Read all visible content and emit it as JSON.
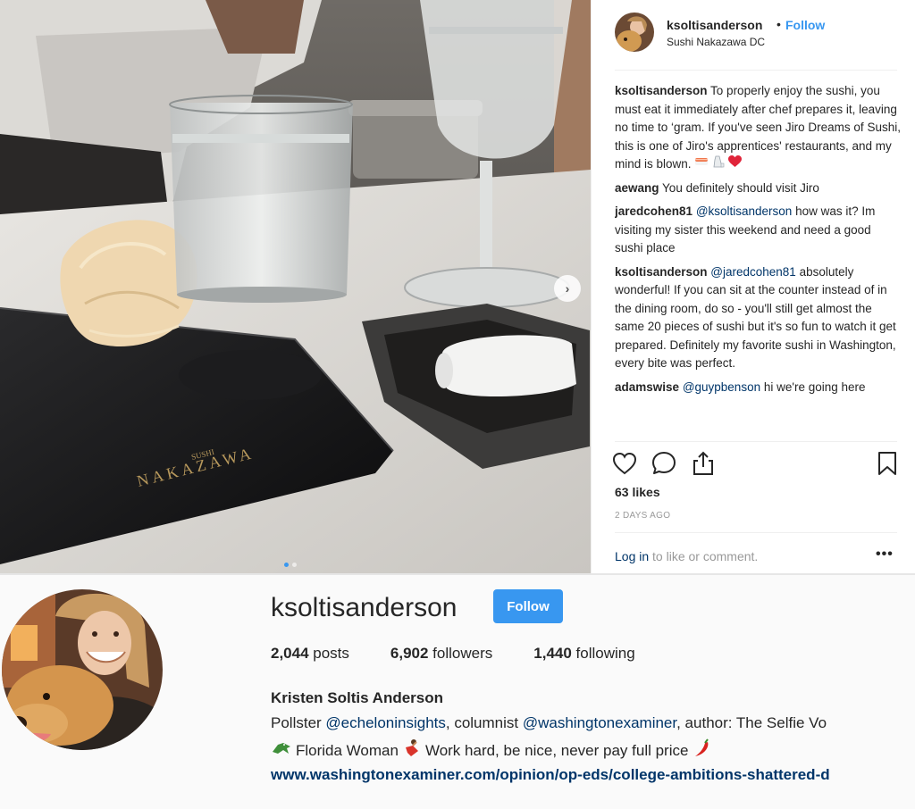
{
  "post": {
    "username": "ksoltisanderson",
    "separator": "•",
    "follow_label": "Follow",
    "location": "Sushi Nakazawa DC",
    "plate_brand_small": "SUSHI",
    "plate_brand": "NAKAZAWA",
    "comments": [
      {
        "user": "ksoltisanderson",
        "mention": "",
        "text": "To properly enjoy the sushi, you must eat it immediately after chef prepares it, leaving no time to ‘gram. If you've seen Jiro Dreams of Sushi, this is one of Jiro's apprentices' restaurants, and my mind is blown."
      },
      {
        "user": "aewang",
        "mention": "",
        "text": "You definitely should visit Jiro"
      },
      {
        "user": "jaredcohen81",
        "mention": "@ksoltisanderson",
        "text": "how was it? Im visiting my sister this weekend and need a good sushi place"
      },
      {
        "user": "ksoltisanderson",
        "mention": "@jaredcohen81",
        "text": "absolutely wonderful! If you can sit at the counter instead of in the dining room, do so - you'll still get almost the same 20 pieces of sushi but it's so fun to watch it get prepared. Definitely my favorite sushi in Washington, every bite was perfect."
      },
      {
        "user": "adamswise",
        "mention": "@guypbenson",
        "text": "hi we're going here"
      }
    ],
    "likes": "63 likes",
    "time": "2 DAYS AGO",
    "login_link": "Log in",
    "login_text": " to like or comment.",
    "more": "•••"
  },
  "profile": {
    "username": "ksoltisanderson",
    "follow_label": "Follow",
    "posts_count": "2,044",
    "posts_label": " posts",
    "followers_count": "6,902",
    "followers_label": " followers",
    "following_count": "1,440",
    "following_label": " following",
    "full_name": "Kristen Soltis Anderson",
    "bio_part1": "Pollster ",
    "bio_mention1": "@echeloninsights",
    "bio_part2": ", columnist ",
    "bio_mention2": "@washingtonexaminer",
    "bio_part3": ", author: The Selfie Vo",
    "bio_line2_a": "Florida Woman",
    "bio_line2_b": "Work hard, be nice, never pay full price",
    "link": "www.washingtonexaminer.com/opinion/op-eds/college-ambitions-shattered-d"
  },
  "colors": {
    "accent": "#3897f0",
    "link": "#003569",
    "text": "#262626",
    "muted": "#999999"
  },
  "icons": [
    "heart-icon",
    "comment-icon",
    "share-icon",
    "bookmark-icon",
    "next-arrow-icon",
    "sushi-emoji",
    "sake-emoji",
    "red-heart-emoji",
    "alligator-emoji",
    "dancer-emoji",
    "chili-pepper-emoji"
  ]
}
